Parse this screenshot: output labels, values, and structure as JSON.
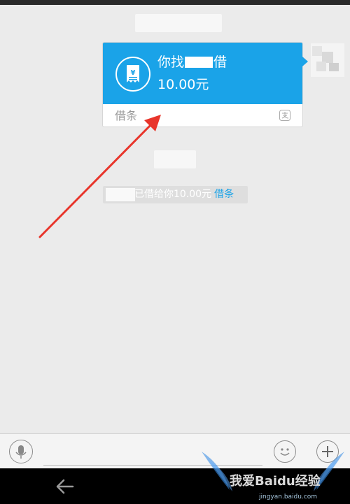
{
  "card": {
    "title_prefix": "你找",
    "title_suffix": "借",
    "amount": "10.00元",
    "footer_label": "借条"
  },
  "system_note": {
    "text": "已借给你10.00元",
    "link": "借条"
  },
  "watermark": {
    "text": "我爱Baidu经验",
    "url": "jingyan.baidu.com"
  },
  "icons": {
    "receipt": "receipt-yen-icon",
    "alipay": "alipay-icon",
    "voice": "microphone-icon",
    "emoji": "smiley-icon",
    "plus": "plus-icon",
    "back": "back-arrow-icon"
  },
  "colors": {
    "accent": "#1aa3e8",
    "arrow": "#e8352b",
    "background": "#ebebeb"
  }
}
